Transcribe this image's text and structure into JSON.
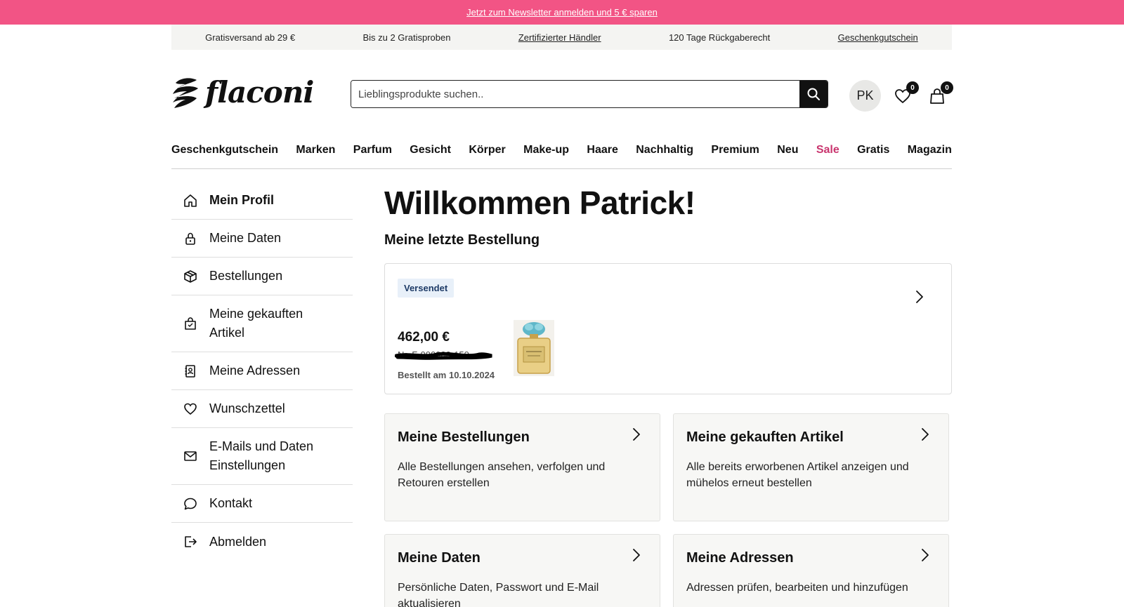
{
  "promo_banner": {
    "text": "Jetzt zum Newsletter anmelden und 5 € sparen"
  },
  "usp_bar": [
    {
      "label": "Gratisversand ab 29 €",
      "link": false
    },
    {
      "label": "Bis zu 2 Gratisproben",
      "link": false
    },
    {
      "label": "Zertifizierter Händler",
      "link": true
    },
    {
      "label": "120 Tage Rückgaberecht",
      "link": false
    },
    {
      "label": "Geschenkgutschein",
      "link": true
    }
  ],
  "header": {
    "logo_text": "flaconi",
    "search": {
      "placeholder": "Lieblingsprodukte suchen..",
      "value": ""
    },
    "avatar_initials": "PK",
    "wishlist_count": "0",
    "cart_count": "0"
  },
  "main_nav": [
    "Geschenkgutschein",
    "Marken",
    "Parfum",
    "Gesicht",
    "Körper",
    "Make-up",
    "Haare",
    "Nachhaltig",
    "Premium",
    "Neu",
    "Sale",
    "Gratis",
    "Magazin"
  ],
  "sidebar": {
    "items": [
      {
        "label": "Mein Profil",
        "icon": "home-icon",
        "active": true
      },
      {
        "label": "Meine Daten",
        "icon": "lock-icon"
      },
      {
        "label": "Bestellungen",
        "icon": "package-icon"
      },
      {
        "label": "Meine gekauften Artikel",
        "icon": "shopping-bag-icon"
      },
      {
        "label": "Meine Adressen",
        "icon": "address-book-icon"
      },
      {
        "label": "Wunschzettel",
        "icon": "heart-icon"
      },
      {
        "label": "E-Mails und Daten Einstellungen",
        "icon": "mail-icon"
      },
      {
        "label": "Kontakt",
        "icon": "chat-bubble-icon"
      },
      {
        "label": "Abmelden",
        "icon": "logout-icon"
      }
    ]
  },
  "main": {
    "welcome": "Willkommen Patrick!",
    "last_order_heading": "Meine letzte Bestellung",
    "last_order": {
      "status": "Versendet",
      "price": "462,00 €",
      "order_number": "Nr. F-000000-150",
      "date": "Bestellt am 10.10.2024",
      "product_icon": "perfume-bottle-icon",
      "colors": {
        "status_bg": "#e8f0f9",
        "status_text": "#1d3a66"
      }
    },
    "tiles": [
      {
        "title": "Meine Bestellungen",
        "description": "Alle Bestellungen ansehen, verfolgen und Retouren erstellen"
      },
      {
        "title": "Meine gekauften Artikel",
        "description": "Alle bereits erworbenen Artikel anzeigen und mühelos erneut bestellen"
      },
      {
        "title": "Meine Daten",
        "description": "Persönliche Daten, Passwort und E-Mail aktualisieren"
      },
      {
        "title": "Meine Adressen",
        "description": "Adressen prüfen, bearbeiten und hinzufügen"
      }
    ]
  },
  "colors": {
    "promo": "#f25485",
    "sale": "#c9356e",
    "usp_bg": "#f4f4f2",
    "tile_bg": "#f7f7f5"
  }
}
